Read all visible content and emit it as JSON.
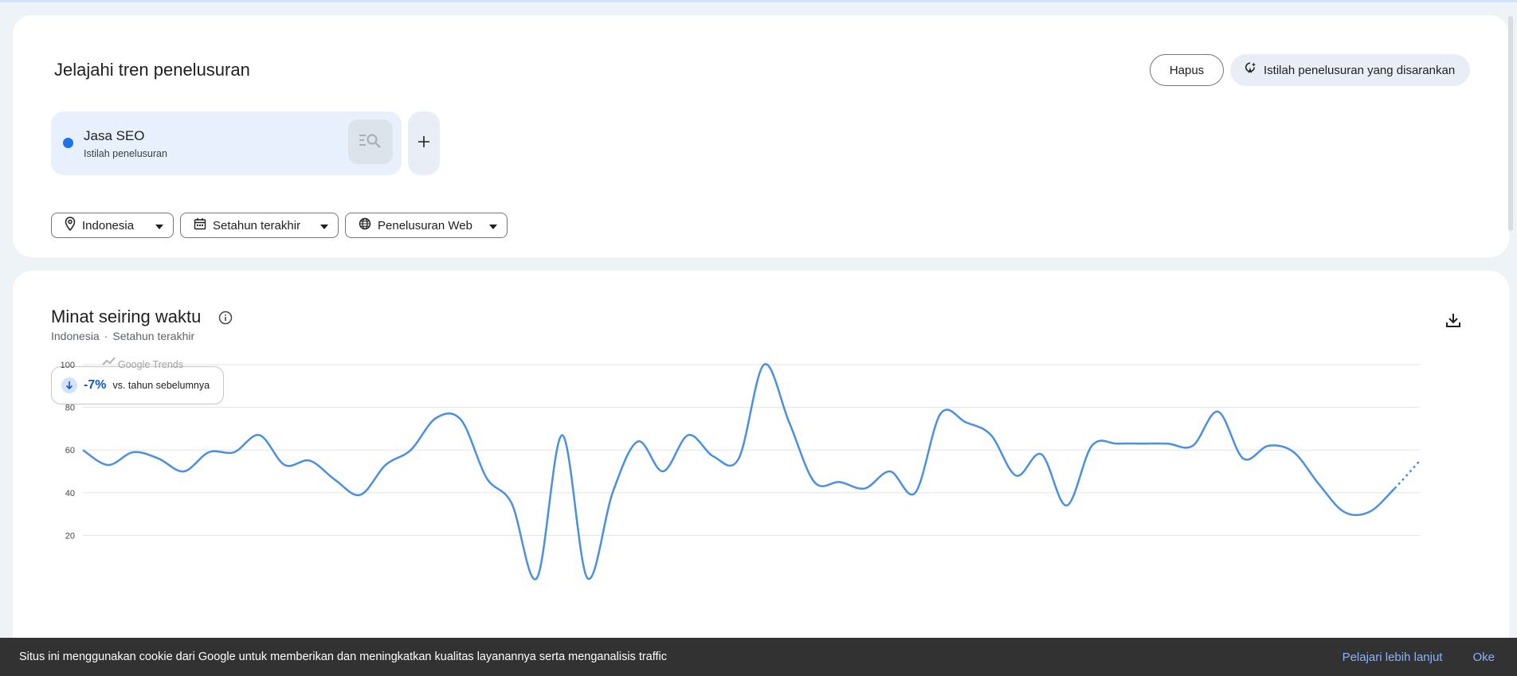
{
  "explore": {
    "title": "Jelajahi tren penelusuran",
    "clear_label": "Hapus",
    "suggest_label": "Istilah penelusuran yang disarankan",
    "term": {
      "name": "Jasa SEO",
      "type": "Istilah penelusuran",
      "color": "#1a73e8"
    },
    "filters": {
      "geo": "Indonesia",
      "time": "Setahun terakhir",
      "property": "Penelusuran Web"
    }
  },
  "interest": {
    "title": "Minat seiring waktu",
    "subtitle_geo": "Indonesia",
    "subtitle_sep": "·",
    "subtitle_time": "Setahun terakhir",
    "change_value": "-7%",
    "change_desc": "vs. tahun sebelumnya",
    "watermark": "Google Trends"
  },
  "chart_data": {
    "type": "line",
    "ylim": [
      0,
      100
    ],
    "yticks": [
      20,
      40,
      60,
      80,
      100
    ],
    "grid": true,
    "series": [
      {
        "values": [
          60,
          53,
          59,
          56,
          50,
          59,
          59,
          67,
          53,
          55,
          46,
          39,
          53,
          60,
          75,
          74,
          47,
          35,
          0,
          67,
          0,
          40,
          64,
          50,
          67,
          57,
          56,
          100,
          73,
          45,
          45,
          42,
          50,
          40,
          77,
          73,
          67,
          48,
          58,
          34,
          62,
          63,
          63,
          63,
          62,
          78,
          56,
          62,
          59,
          44,
          31,
          31,
          42,
          55
        ],
        "partial_last": true,
        "color": "#4a8fe0"
      }
    ]
  },
  "cookie": {
    "text": "Situs ini menggunakan cookie dari Google untuk memberikan dan meningkatkan kualitas layanannya serta menganalisis traffic",
    "learn_more": "Pelajari lebih lanjut",
    "ok": "Oke"
  }
}
